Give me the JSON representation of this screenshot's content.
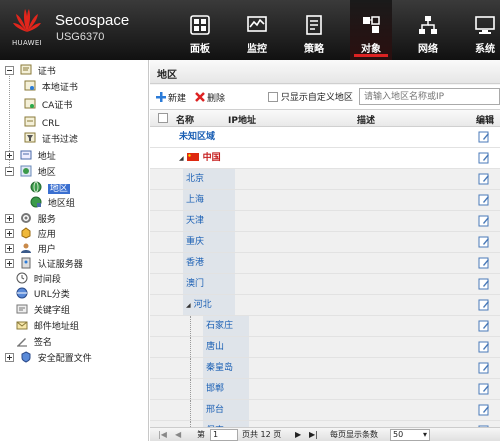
{
  "header": {
    "brand": "HUAWEI",
    "product_name": "Secospace",
    "product_model": "USG6370",
    "nav": [
      {
        "label": "面板",
        "icon": "dashboard-icon"
      },
      {
        "label": "监控",
        "icon": "monitor-icon"
      },
      {
        "label": "策略",
        "icon": "policy-icon"
      },
      {
        "label": "对象",
        "icon": "object-icon",
        "active": true
      },
      {
        "label": "网络",
        "icon": "network-icon"
      },
      {
        "label": "系统",
        "icon": "system-icon"
      }
    ]
  },
  "sidebar": {
    "certificate": "证书",
    "local_cert": "本地证书",
    "ca_cert": "CA证书",
    "crl": "CRL",
    "cert_filter": "证书过滤",
    "address": "地址",
    "region": "地区",
    "region_leaf": "地区",
    "region_group": "地区组",
    "service": "服务",
    "application": "应用",
    "user": "用户",
    "auth_server": "认证服务器",
    "time_range": "时间段",
    "url_category": "URL分类",
    "keyword_group": "关键字组",
    "mail_group": "邮件地址组",
    "signature": "签名",
    "security_profile": "安全配置文件"
  },
  "main": {
    "title": "地区",
    "toolbar": {
      "new_label": "新建",
      "delete_label": "删除",
      "custom_only_label": "只显示自定义地区",
      "search_placeholder": "请输入地区名称或IP"
    },
    "columns": {
      "name": "名称",
      "ip": "IP地址",
      "desc": "描述",
      "edit": "编辑"
    },
    "rows": [
      {
        "name": "未知区域",
        "level": 0,
        "bold": true
      },
      {
        "name": "中国",
        "level": 1,
        "bold": true,
        "flag": true,
        "expanded": true
      },
      {
        "name": "北京",
        "level": 2
      },
      {
        "name": "上海",
        "level": 2
      },
      {
        "name": "天津",
        "level": 2
      },
      {
        "name": "重庆",
        "level": 2
      },
      {
        "name": "香港",
        "level": 2
      },
      {
        "name": "澳门",
        "level": 2
      },
      {
        "name": "河北",
        "level": 2,
        "expanded": true
      },
      {
        "name": "石家庄",
        "level": 3
      },
      {
        "name": "唐山",
        "level": 3
      },
      {
        "name": "秦皇岛",
        "level": 3
      },
      {
        "name": "邯郸",
        "level": 3
      },
      {
        "name": "邢台",
        "level": 3
      },
      {
        "name": "保定",
        "level": 3
      }
    ],
    "pager": {
      "page_label": "第",
      "current_page": "1",
      "total_label": "页共 12 页",
      "per_page_label": "每页显示条数",
      "per_page": "50"
    }
  }
}
